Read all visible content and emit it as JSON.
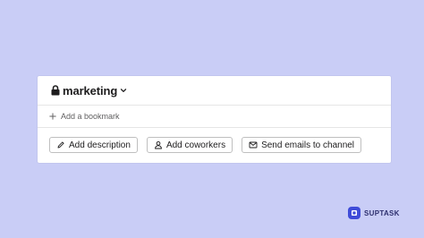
{
  "channel": {
    "name": "marketing",
    "lock_icon": "lock-icon",
    "dropdown_icon": "chevron-down-icon"
  },
  "bookmarks": {
    "add_label": "Add a bookmark",
    "icon": "plus-icon"
  },
  "actions": [
    {
      "label": "Add description",
      "icon": "pencil-icon"
    },
    {
      "label": "Add coworkers",
      "icon": "person-icon"
    },
    {
      "label": "Send emails to channel",
      "icon": "email-icon"
    }
  ],
  "brand": {
    "name": "SUPTASK",
    "logo_color": "#3e4bd8"
  },
  "colors": {
    "background": "#c9cdf6",
    "card": "#ffffff",
    "text": "#1d1c1d",
    "muted": "#616061"
  }
}
